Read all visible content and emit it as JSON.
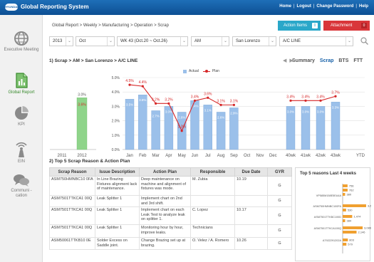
{
  "app": {
    "logo_text": "HYUNDAI",
    "title": "Global Reporting System",
    "links": [
      "Home",
      "Logout",
      "Change Password",
      "Help"
    ]
  },
  "sidebar": {
    "items": [
      {
        "label": "Executive Meeting",
        "icon": "globe-icon",
        "active": false
      },
      {
        "label": "Global Report",
        "icon": "report-document-icon",
        "active": true
      },
      {
        "label": "KPI",
        "icon": "pie-chart-icon",
        "active": false
      },
      {
        "label": "EIN",
        "icon": "wireless-tower-icon",
        "active": false
      },
      {
        "label": "Communi -cation",
        "icon": "chat-bubbles-icon",
        "active": false
      }
    ]
  },
  "breadcrumb": "Global Report > Weekly > Manufacturing > Operation > Scrap",
  "buttons": {
    "action_items": {
      "label": "Action Items",
      "count": "0"
    },
    "attachment": {
      "label": "Attachment",
      "count": "0"
    }
  },
  "filters": {
    "year": "2013",
    "month": "Oct",
    "week": "WK 43 (Oct.20 ~ Oct.26)",
    "shift": "AM",
    "plant": "San Lorenzo",
    "line": "A/C LINE"
  },
  "section1": {
    "title": "1) Scrap > AM > San Lorenzo > A/C LINE",
    "view_tabs": [
      "Summary",
      "Scrap",
      "BTS",
      "FTT"
    ],
    "active_tab": "Scrap"
  },
  "chart_data": {
    "type": "bar",
    "legend": [
      "Actual",
      "Plan"
    ],
    "legend_position": "top-center",
    "y_ticks": [
      "0.0%",
      "1.0%",
      "2.0%",
      "3.0%",
      "4.0%",
      "5.0%"
    ],
    "ylim": [
      0,
      5
    ],
    "yearly": {
      "categories": [
        "2011",
        "2012"
      ],
      "actual": [
        null,
        3.6
      ],
      "labels": [
        "",
        "3.6%"
      ],
      "plan_label": "3.0%"
    },
    "monthly": {
      "categories": [
        "Jan",
        "Feb",
        "Mar",
        "Apr",
        "May",
        "Jun",
        "Jul",
        "Aug",
        "Sep",
        "Oct",
        "Nov",
        "Dec"
      ],
      "actual": [
        3.5,
        3.8,
        2.7,
        3.0,
        2.6,
        3.4,
        3.1,
        2.6,
        2.9,
        null,
        null,
        null
      ],
      "actual_labels": [
        "3.5%",
        "3.8%",
        "2.7%",
        "3.0%",
        "2.6%",
        "3.4%",
        "3.1%",
        "2.6%",
        "2.9%",
        "",
        "",
        ""
      ],
      "plan": [
        4.5,
        4.4,
        3.2,
        3.2,
        1.3,
        3.4,
        3.6,
        3.1,
        3.1,
        null,
        null,
        null
      ],
      "plan_labels": [
        "4.5%",
        "4.4%",
        "3.2%",
        "3.2%",
        "1.3%",
        "3.4%",
        "3.6%",
        "3.1%",
        "3.1%",
        "",
        "",
        ""
      ]
    },
    "weekly": {
      "categories": [
        "40wk",
        "41wk",
        "42wk",
        "43wk"
      ],
      "actual": [
        3.0,
        3.0,
        3.0,
        3.3
      ],
      "actual_labels": [
        "3.0%",
        "3.0%",
        "3.0%",
        "3.3%"
      ],
      "plan": [
        3.4,
        3.4,
        3.4,
        3.7
      ],
      "plan_labels": [
        "3.4%",
        "3.4%",
        "3.4%",
        "3.7%"
      ]
    },
    "ytd": {
      "category": "YTD",
      "value": null
    },
    "colors": {
      "actual_bar": "#9bc0ea",
      "ytd_bar": "#8fd48a",
      "plan_line": "#d62728"
    }
  },
  "section2": {
    "title": "2) Top 5 Scrap Reason & Action Plan",
    "columns": [
      "Scrap Reason",
      "Issue Description",
      "Action Plan",
      "Responsible",
      "Due Date",
      "GYR"
    ],
    "rows": [
      [
        "ASM750HMNBC10 0FA",
        "In Line Brazing Fixtures alignment lack of maintenance.",
        "Deep maintenance on machine and alignment of fixtures was mode.",
        "M. Zubia",
        "10.19",
        "G"
      ],
      [
        "ASM7501TTKCA1 00Q",
        "Leak Splitter 1",
        "Implement chart on 2nd and 3rd shift.",
        "",
        "",
        "G"
      ],
      [
        "ASM7501TTKCA1 00Q",
        "Leak Splitter 1",
        "Implement chart on each Leak Test to analyze leak on splitter 1.",
        "C. Lopez",
        "10.17",
        "G"
      ],
      [
        "ASM7501TTKCA1 00Q",
        "Leak Splitter 1",
        "Monitoring hour by hour, improve leaks.",
        "Technicians",
        "",
        "G"
      ],
      [
        "ASM50061TTKB10 0E",
        "Solder Excess on Saddle joint.",
        "Change Brazing set up at brazing.",
        "O. Velez / A. Romero",
        "10.26",
        "G"
      ]
    ]
  },
  "top5_panel": {
    "title": "Top 5 reasons Last 4 weeks",
    "rows": [
      {
        "label": "",
        "values": [
          "756",
          "762",
          "380"
        ]
      },
      {
        "label": "VP585M158E5EA4A",
        "values": []
      },
      {
        "label": "ASM750HMNBC100FA",
        "values": [
          "3,625",
          "530"
        ]
      },
      {
        "label": "ASM7501TTKBC100D",
        "values": [
          "1,474",
          "384"
        ]
      },
      {
        "label": "ASM7501TTKCA100Q",
        "values": [
          "3,086",
          "2,146"
        ]
      },
      {
        "label": "A7922291202A",
        "values": [
          "803",
          "579"
        ]
      }
    ]
  }
}
